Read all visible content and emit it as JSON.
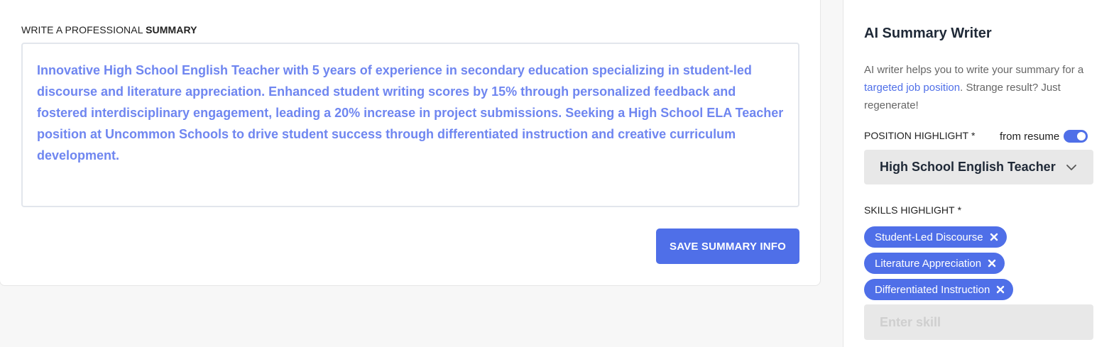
{
  "summary_section": {
    "label_prefix": "WRITE A PROFESSIONAL ",
    "label_bold": "SUMMARY",
    "text": "Innovative High School English Teacher with 5 years of experience in secondary education specializing in student-led discourse and literature appreciation. Enhanced student writing scores by 15% through personalized feedback and fostered interdisciplinary engagement, leading a 20% increase in project submissions. Seeking a High School ELA Teacher position at Uncommon Schools to drive student success through differentiated instruction and creative curriculum development.",
    "save_label": "SAVE SUMMARY INFO"
  },
  "ai_panel": {
    "title": "AI Summary Writer",
    "desc_prefix": "AI writer helps you to write your summary for a ",
    "desc_link": "targeted job position",
    "desc_suffix": ". Strange result? Just regenerate!",
    "position_label": "POSITION HIGHLIGHT",
    "required_mark": "*",
    "toggle_label": "from resume",
    "toggle_on": true,
    "selected_position": "High School English Teacher",
    "skills_label": "SKILLS HIGHLIGHT",
    "skills": [
      {
        "label": "Student-Led Discourse"
      },
      {
        "label": "Literature Appreciation"
      },
      {
        "label": "Differentiated Instruction"
      }
    ],
    "skill_placeholder": "Enter skill"
  },
  "colors": {
    "accent": "#4f6fe8",
    "summary_text": "#6f86f0",
    "field_bg": "#e8e8e8"
  }
}
